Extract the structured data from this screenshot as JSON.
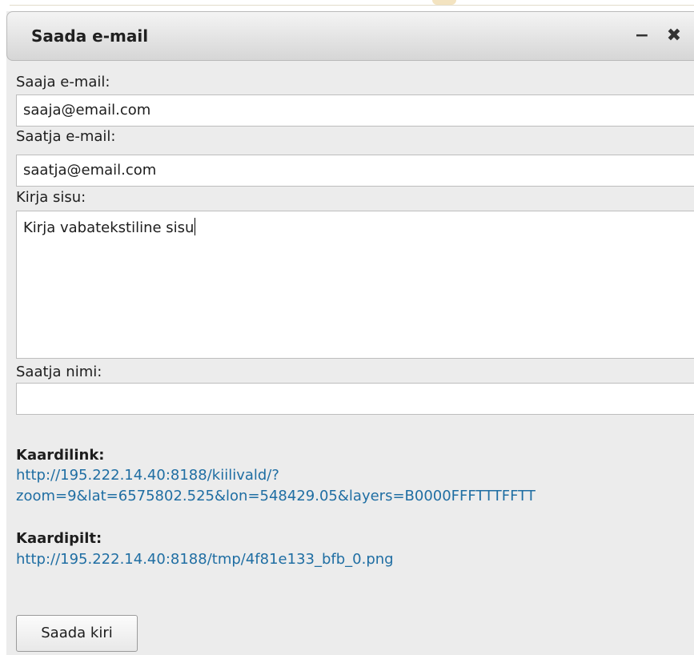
{
  "dialog": {
    "title": "Saada e-mail",
    "minimize_glyph": "−",
    "close_glyph": "✖"
  },
  "form": {
    "recipient_label": "Saaja e-mail:",
    "recipient_value": "saaja@email.com",
    "sender_label": "Saatja e-mail:",
    "sender_value": "saatja@email.com",
    "body_label": "Kirja sisu:",
    "body_value": "Kirja vabatekstiline sisu",
    "sender_name_label": "Saatja nimi:",
    "sender_name_value": ""
  },
  "map_link": {
    "heading": "Kaardilink:",
    "url_line1": "http://195.222.14.40:8188/kiilivald/?",
    "url_line2": "zoom=9&lat=6575802.525&lon=548429.05&layers=B0000FFFTTTFFTT"
  },
  "map_image": {
    "heading": "Kaardipilt:",
    "url": "http://195.222.14.40:8188/tmp/4f81e133_bfb_0.png"
  },
  "submit_label": "Saada kiri"
}
